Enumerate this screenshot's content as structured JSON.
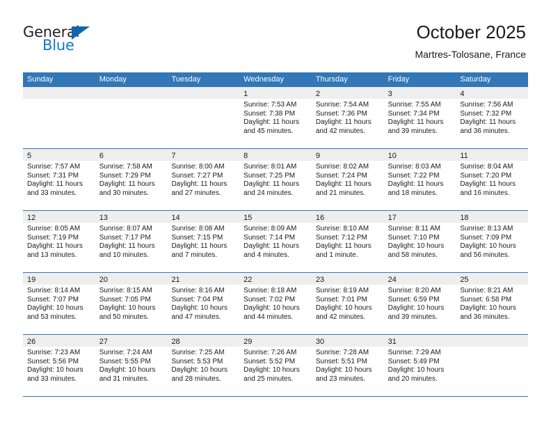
{
  "brand": {
    "name_part1": "General",
    "name_part2": "Blue",
    "accent_color": "#1577c4",
    "triangle_color": "#1266ad",
    "triangle_icon": "triangle-icon"
  },
  "header": {
    "title": "October 2025",
    "subtitle": "Martres-Tolosane, France"
  },
  "theme": {
    "header_bar_color": "#3277b6",
    "day_strip_color": "#eeeeee",
    "grid_line_color": "#3277b6",
    "text_color": "#1a1a1a"
  },
  "weekdays": [
    "Sunday",
    "Monday",
    "Tuesday",
    "Wednesday",
    "Thursday",
    "Friday",
    "Saturday"
  ],
  "weeks": [
    [
      {
        "day": "",
        "empty": true,
        "lines": []
      },
      {
        "day": "",
        "empty": true,
        "lines": []
      },
      {
        "day": "",
        "empty": true,
        "lines": []
      },
      {
        "day": "1",
        "empty": false,
        "lines": [
          "Sunrise: 7:53 AM",
          "Sunset: 7:38 PM",
          "Daylight: 11 hours",
          "and 45 minutes."
        ]
      },
      {
        "day": "2",
        "empty": false,
        "lines": [
          "Sunrise: 7:54 AM",
          "Sunset: 7:36 PM",
          "Daylight: 11 hours",
          "and 42 minutes."
        ]
      },
      {
        "day": "3",
        "empty": false,
        "lines": [
          "Sunrise: 7:55 AM",
          "Sunset: 7:34 PM",
          "Daylight: 11 hours",
          "and 39 minutes."
        ]
      },
      {
        "day": "4",
        "empty": false,
        "lines": [
          "Sunrise: 7:56 AM",
          "Sunset: 7:32 PM",
          "Daylight: 11 hours",
          "and 36 minutes."
        ]
      }
    ],
    [
      {
        "day": "5",
        "empty": false,
        "lines": [
          "Sunrise: 7:57 AM",
          "Sunset: 7:31 PM",
          "Daylight: 11 hours",
          "and 33 minutes."
        ]
      },
      {
        "day": "6",
        "empty": false,
        "lines": [
          "Sunrise: 7:58 AM",
          "Sunset: 7:29 PM",
          "Daylight: 11 hours",
          "and 30 minutes."
        ]
      },
      {
        "day": "7",
        "empty": false,
        "lines": [
          "Sunrise: 8:00 AM",
          "Sunset: 7:27 PM",
          "Daylight: 11 hours",
          "and 27 minutes."
        ]
      },
      {
        "day": "8",
        "empty": false,
        "lines": [
          "Sunrise: 8:01 AM",
          "Sunset: 7:25 PM",
          "Daylight: 11 hours",
          "and 24 minutes."
        ]
      },
      {
        "day": "9",
        "empty": false,
        "lines": [
          "Sunrise: 8:02 AM",
          "Sunset: 7:24 PM",
          "Daylight: 11 hours",
          "and 21 minutes."
        ]
      },
      {
        "day": "10",
        "empty": false,
        "lines": [
          "Sunrise: 8:03 AM",
          "Sunset: 7:22 PM",
          "Daylight: 11 hours",
          "and 18 minutes."
        ]
      },
      {
        "day": "11",
        "empty": false,
        "lines": [
          "Sunrise: 8:04 AM",
          "Sunset: 7:20 PM",
          "Daylight: 11 hours",
          "and 16 minutes."
        ]
      }
    ],
    [
      {
        "day": "12",
        "empty": false,
        "lines": [
          "Sunrise: 8:05 AM",
          "Sunset: 7:19 PM",
          "Daylight: 11 hours",
          "and 13 minutes."
        ]
      },
      {
        "day": "13",
        "empty": false,
        "lines": [
          "Sunrise: 8:07 AM",
          "Sunset: 7:17 PM",
          "Daylight: 11 hours",
          "and 10 minutes."
        ]
      },
      {
        "day": "14",
        "empty": false,
        "lines": [
          "Sunrise: 8:08 AM",
          "Sunset: 7:15 PM",
          "Daylight: 11 hours",
          "and 7 minutes."
        ]
      },
      {
        "day": "15",
        "empty": false,
        "lines": [
          "Sunrise: 8:09 AM",
          "Sunset: 7:14 PM",
          "Daylight: 11 hours",
          "and 4 minutes."
        ]
      },
      {
        "day": "16",
        "empty": false,
        "lines": [
          "Sunrise: 8:10 AM",
          "Sunset: 7:12 PM",
          "Daylight: 11 hours",
          "and 1 minute."
        ]
      },
      {
        "day": "17",
        "empty": false,
        "lines": [
          "Sunrise: 8:11 AM",
          "Sunset: 7:10 PM",
          "Daylight: 10 hours",
          "and 58 minutes."
        ]
      },
      {
        "day": "18",
        "empty": false,
        "lines": [
          "Sunrise: 8:13 AM",
          "Sunset: 7:09 PM",
          "Daylight: 10 hours",
          "and 56 minutes."
        ]
      }
    ],
    [
      {
        "day": "19",
        "empty": false,
        "lines": [
          "Sunrise: 8:14 AM",
          "Sunset: 7:07 PM",
          "Daylight: 10 hours",
          "and 53 minutes."
        ]
      },
      {
        "day": "20",
        "empty": false,
        "lines": [
          "Sunrise: 8:15 AM",
          "Sunset: 7:05 PM",
          "Daylight: 10 hours",
          "and 50 minutes."
        ]
      },
      {
        "day": "21",
        "empty": false,
        "lines": [
          "Sunrise: 8:16 AM",
          "Sunset: 7:04 PM",
          "Daylight: 10 hours",
          "and 47 minutes."
        ]
      },
      {
        "day": "22",
        "empty": false,
        "lines": [
          "Sunrise: 8:18 AM",
          "Sunset: 7:02 PM",
          "Daylight: 10 hours",
          "and 44 minutes."
        ]
      },
      {
        "day": "23",
        "empty": false,
        "lines": [
          "Sunrise: 8:19 AM",
          "Sunset: 7:01 PM",
          "Daylight: 10 hours",
          "and 42 minutes."
        ]
      },
      {
        "day": "24",
        "empty": false,
        "lines": [
          "Sunrise: 8:20 AM",
          "Sunset: 6:59 PM",
          "Daylight: 10 hours",
          "and 39 minutes."
        ]
      },
      {
        "day": "25",
        "empty": false,
        "lines": [
          "Sunrise: 8:21 AM",
          "Sunset: 6:58 PM",
          "Daylight: 10 hours",
          "and 36 minutes."
        ]
      }
    ],
    [
      {
        "day": "26",
        "empty": false,
        "lines": [
          "Sunrise: 7:23 AM",
          "Sunset: 5:56 PM",
          "Daylight: 10 hours",
          "and 33 minutes."
        ]
      },
      {
        "day": "27",
        "empty": false,
        "lines": [
          "Sunrise: 7:24 AM",
          "Sunset: 5:55 PM",
          "Daylight: 10 hours",
          "and 31 minutes."
        ]
      },
      {
        "day": "28",
        "empty": false,
        "lines": [
          "Sunrise: 7:25 AM",
          "Sunset: 5:53 PM",
          "Daylight: 10 hours",
          "and 28 minutes."
        ]
      },
      {
        "day": "29",
        "empty": false,
        "lines": [
          "Sunrise: 7:26 AM",
          "Sunset: 5:52 PM",
          "Daylight: 10 hours",
          "and 25 minutes."
        ]
      },
      {
        "day": "30",
        "empty": false,
        "lines": [
          "Sunrise: 7:28 AM",
          "Sunset: 5:51 PM",
          "Daylight: 10 hours",
          "and 23 minutes."
        ]
      },
      {
        "day": "31",
        "empty": false,
        "lines": [
          "Sunrise: 7:29 AM",
          "Sunset: 5:49 PM",
          "Daylight: 10 hours",
          "and 20 minutes."
        ]
      },
      {
        "day": "",
        "empty": true,
        "lines": []
      }
    ]
  ]
}
